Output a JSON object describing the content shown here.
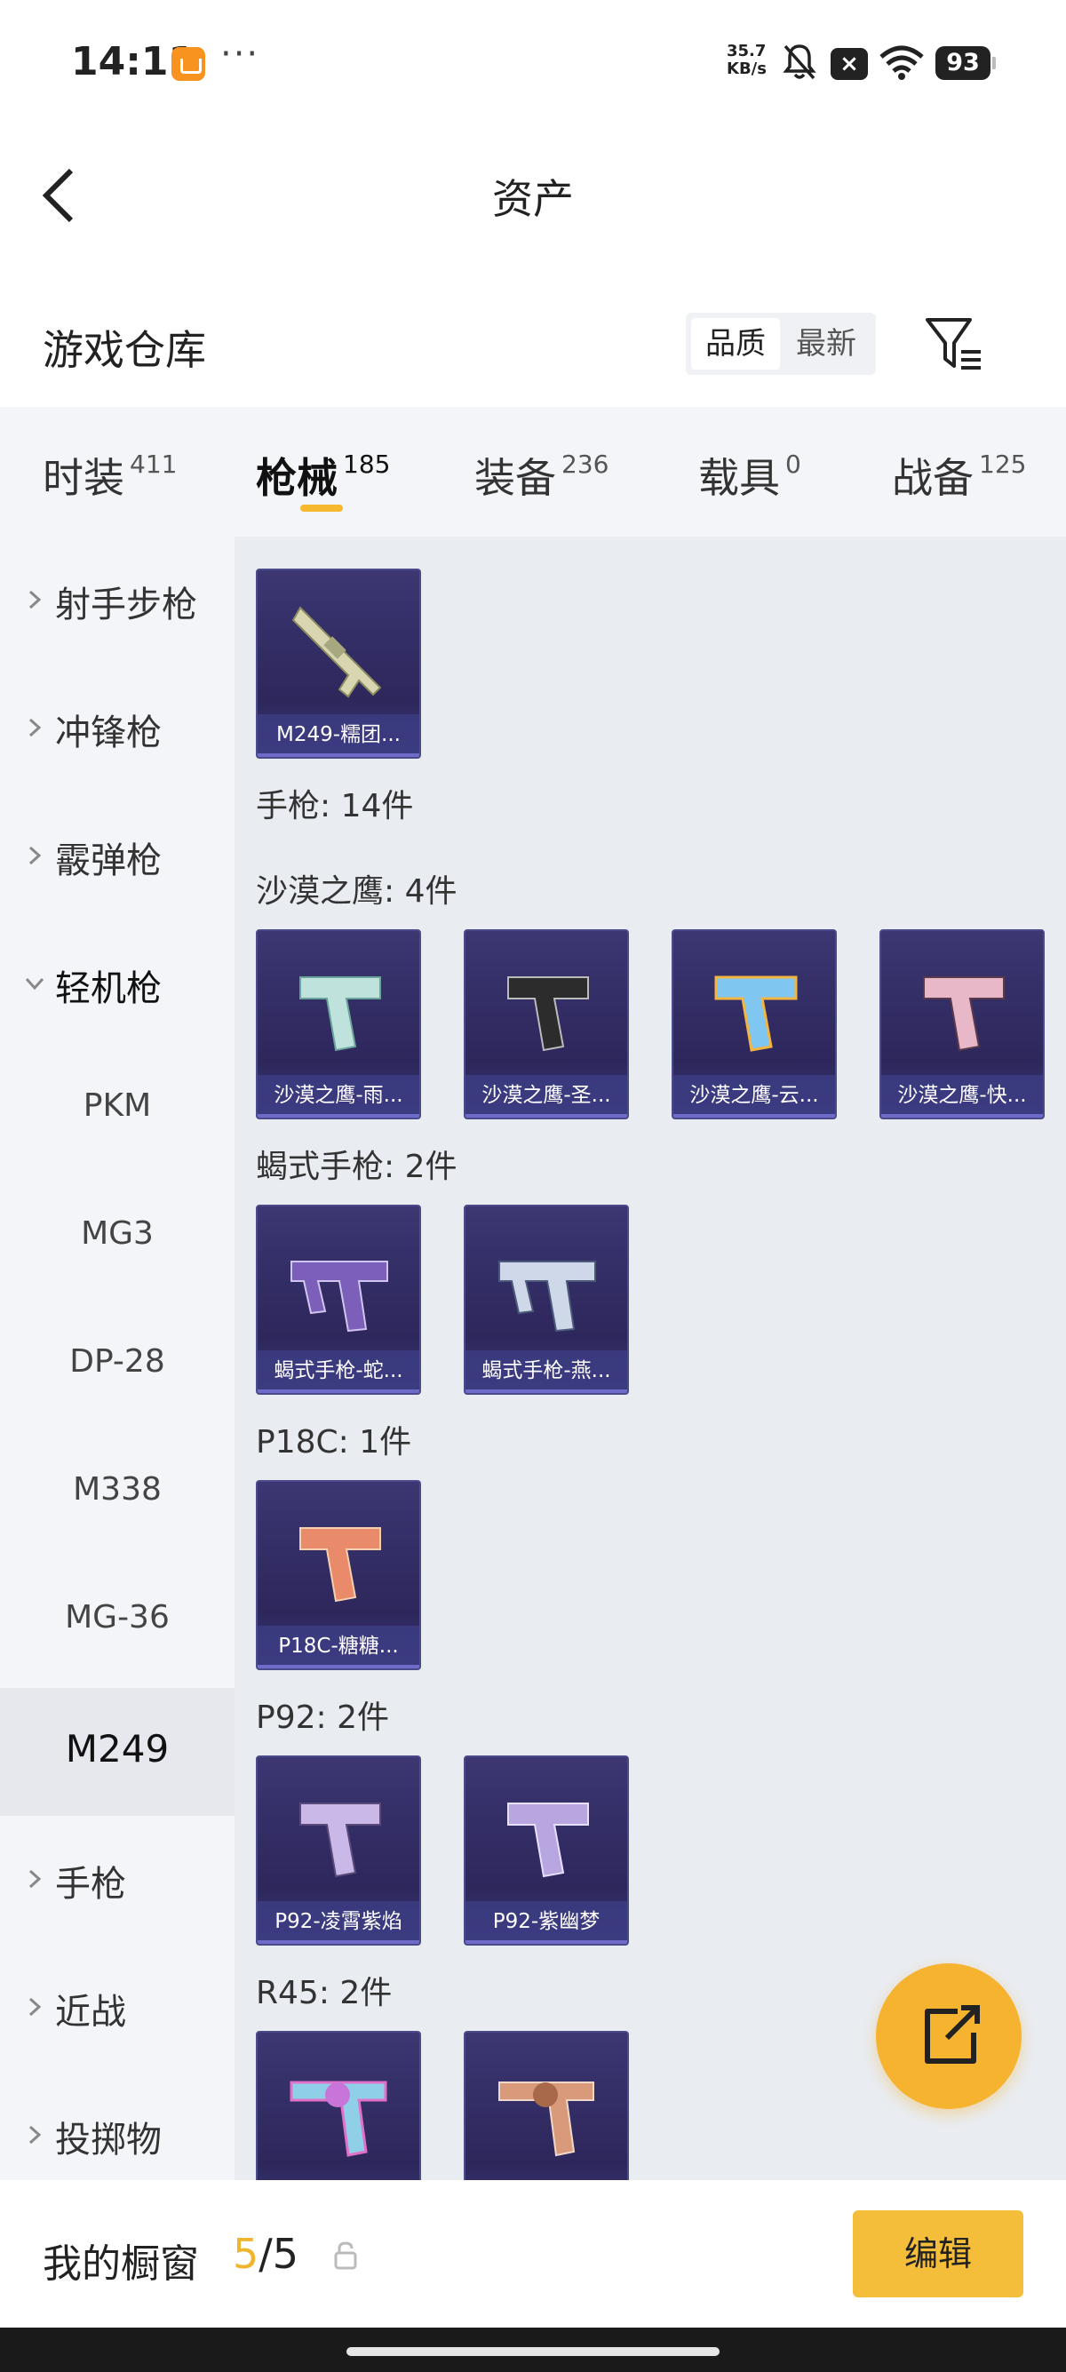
{
  "status_bar": {
    "time": "14:11",
    "dots": "···",
    "net_speed_value": "35.7",
    "net_speed_unit": "KB/s",
    "battery": "93"
  },
  "header": {
    "title": "资产"
  },
  "section": {
    "title": "游戏仓库",
    "sort_quality": "品质",
    "sort_newest": "最新"
  },
  "tabs": [
    {
      "label": "时装",
      "count": "411"
    },
    {
      "label": "枪械",
      "count": "185"
    },
    {
      "label": "装备",
      "count": "236"
    },
    {
      "label": "载具",
      "count": "0"
    },
    {
      "label": "战备",
      "count": "125"
    }
  ],
  "sidebar": [
    {
      "label": "射手步枪"
    },
    {
      "label": "冲锋枪"
    },
    {
      "label": "霰弹枪"
    },
    {
      "label": "轻机枪"
    },
    {
      "label": "PKM"
    },
    {
      "label": "MG3"
    },
    {
      "label": "DP-28"
    },
    {
      "label": "M338"
    },
    {
      "label": "MG-36"
    },
    {
      "label": "M249"
    },
    {
      "label": "手枪"
    },
    {
      "label": "近战"
    },
    {
      "label": "投掷物"
    }
  ],
  "content": {
    "m249_cards": [
      "M249-糯团..."
    ],
    "pistol_header": "手枪: 14件",
    "desert_eagle_header": "沙漠之鹰: 4件",
    "desert_eagle_cards": [
      "沙漠之鹰-雨...",
      "沙漠之鹰-圣...",
      "沙漠之鹰-云...",
      "沙漠之鹰-快..."
    ],
    "scorpion_header": "蝎式手枪: 2件",
    "scorpion_cards": [
      "蝎式手枪-蛇...",
      "蝎式手枪-燕..."
    ],
    "p18c_header": "P18C: 1件",
    "p18c_cards": [
      "P18C-糖糖..."
    ],
    "p92_header": "P92: 2件",
    "p92_cards": [
      "P92-凌霄紫焰",
      "P92-紫幽梦"
    ],
    "r45_header": "R45: 2件"
  },
  "bottom_bar": {
    "label": "我的橱窗",
    "count_current": "5",
    "count_separator": "/",
    "count_total": "5",
    "edit_label": "编辑"
  },
  "colors": {
    "accent": "#f5b82e",
    "card_bg": "#2d275c",
    "sidebar_bg": "#f4f5f8",
    "content_bg": "#e9ecf1"
  }
}
